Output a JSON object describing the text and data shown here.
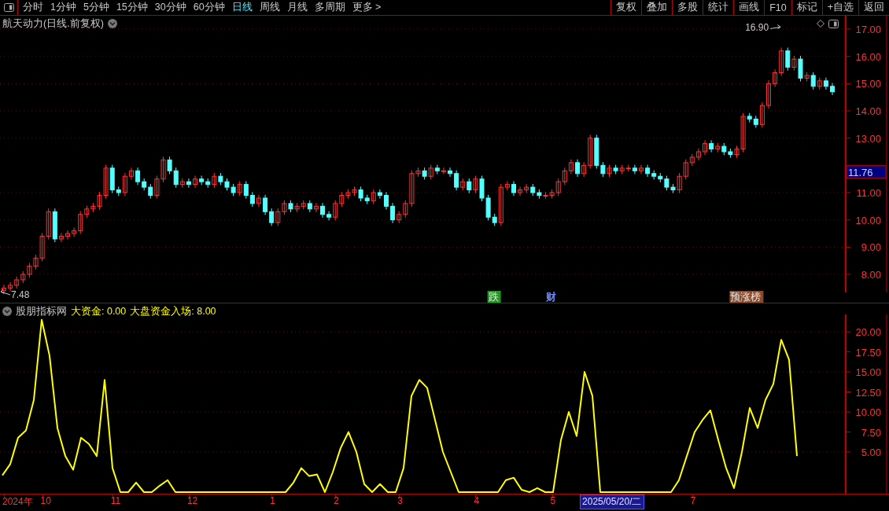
{
  "toolbar": {
    "periods": [
      {
        "label": "分时",
        "selected": false
      },
      {
        "label": "1分钟",
        "selected": false
      },
      {
        "label": "5分钟",
        "selected": false
      },
      {
        "label": "15分钟",
        "selected": false
      },
      {
        "label": "30分钟",
        "selected": false
      },
      {
        "label": "60分钟",
        "selected": false
      },
      {
        "label": "日线",
        "selected": true
      },
      {
        "label": "周线",
        "selected": false
      },
      {
        "label": "月线",
        "selected": false
      },
      {
        "label": "多周期",
        "selected": false
      },
      {
        "label": "更多 >",
        "selected": false
      }
    ],
    "buttons": [
      "复权",
      "叠加",
      "多股",
      "统计",
      "画线",
      "F10",
      "标记",
      "+自选",
      "返回"
    ]
  },
  "main_panel": {
    "title": "航天动力(日线.前复权)",
    "price_axis": [
      "17.00",
      "16.00",
      "15.00",
      "14.00",
      "13.00",
      "11.00",
      "10.00",
      "9.00",
      "8.00"
    ],
    "current_price": "11.76",
    "high_label": "16.90",
    "low_label": "7.48",
    "events": [
      {
        "text": "跌",
        "color": "#1f9a1f",
        "filled": true
      },
      {
        "text": "财",
        "color": "#6f8cff",
        "filled": false
      },
      {
        "text": "预涨榜",
        "color": "#8a4b2c",
        "filled": true
      }
    ]
  },
  "indicator_panel": {
    "name": "股朋指标网",
    "readouts": [
      "大资金: 0.00",
      "大盘资金入场: 8.00"
    ],
    "chart_data": {
      "type": "line",
      "grid": true,
      "ylim": [
        0,
        22.16
      ],
      "yticks": [
        {
          "value": 20,
          "label": "20.00"
        },
        {
          "value": 17.5,
          "label": "17.50"
        },
        {
          "value": 15,
          "label": "15.00"
        },
        {
          "value": 12.5,
          "label": "12.50"
        },
        {
          "value": 10,
          "label": "10.00"
        },
        {
          "value": 7.5,
          "label": "7.50"
        },
        {
          "value": 5,
          "label": "5.00"
        }
      ],
      "series": [
        {
          "color": "#ffff00",
          "values": [
            2.1,
            3.5,
            6.8,
            7.7,
            11.5,
            21.5,
            17.0,
            8.0,
            4.5,
            2.8,
            6.8,
            6.0,
            4.5,
            14.0,
            3.0,
            0,
            0,
            1.2,
            0,
            0,
            0.8,
            1.5,
            0,
            0,
            0,
            0,
            0,
            0,
            0,
            0,
            0,
            0,
            0,
            0,
            0,
            0,
            0,
            1.2,
            3.0,
            2.0,
            2.2,
            0,
            2.5,
            5.5,
            7.5,
            5.0,
            1.0,
            0,
            1.0,
            0,
            0,
            3.0,
            12.0,
            14.0,
            13.0,
            9.0,
            5.0,
            2.5,
            0,
            0,
            0,
            0,
            0,
            0,
            1.5,
            1.8,
            0.3,
            0,
            0.5,
            0,
            0,
            6.5,
            10.0,
            7.0,
            15.0,
            12.0,
            0,
            0,
            0,
            0,
            0,
            0,
            0,
            0,
            0,
            0,
            1.5,
            4.5,
            7.5,
            9.0,
            10.2,
            6.5,
            3.0,
            0.5,
            5.0,
            10.5,
            8.0,
            11.5,
            13.5,
            19.0,
            16.5,
            4.5
          ]
        }
      ]
    }
  },
  "date_axis": {
    "labels": [
      "2024年",
      "10",
      "11",
      "12",
      "1",
      "2",
      "3",
      "4",
      "5",
      "7"
    ],
    "cursor": "2025/05/20/二"
  }
}
